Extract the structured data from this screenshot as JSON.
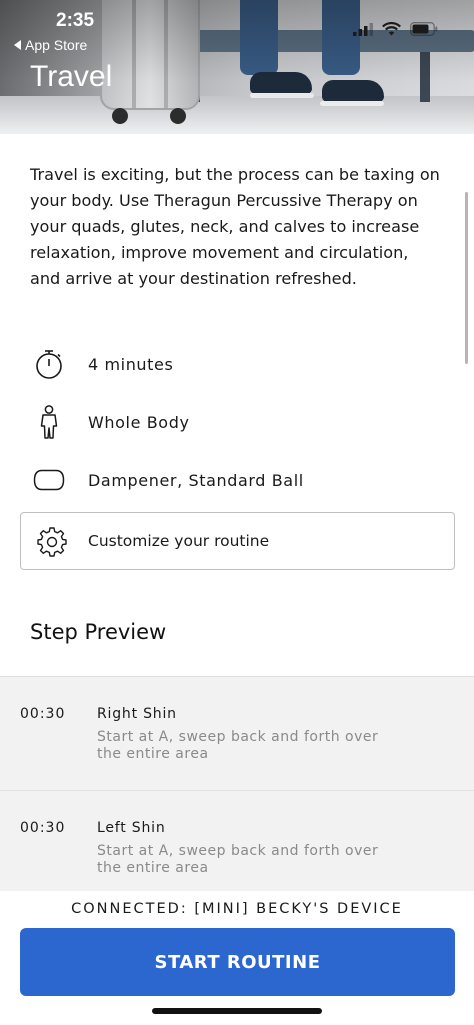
{
  "status_bar": {
    "time": "2:35",
    "back_label": "App Store",
    "icons": [
      "cellular-signal",
      "wifi",
      "battery"
    ]
  },
  "header": {
    "title": "Travel"
  },
  "description": "Travel is exciting, but the process can be taxing on your body. Use Theragun Percussive Therapy on your quads, glutes, neck, and calves to increase relaxation, improve movement and circulation, and arrive at your destination refreshed.",
  "info": {
    "duration": {
      "icon": "stopwatch-icon",
      "label": "4 minutes"
    },
    "body_area": {
      "icon": "person-icon",
      "label": "Whole Body"
    },
    "attachments": {
      "icon": "dampener-icon",
      "label": "Dampener, Standard Ball"
    }
  },
  "customize": {
    "icon": "gear-icon",
    "label": "Customize your routine"
  },
  "step_preview": {
    "title": "Step Preview",
    "steps": [
      {
        "time": "00:30",
        "name": "Right Shin",
        "instruction": "Start at A, sweep back and forth over the entire area"
      },
      {
        "time": "00:30",
        "name": "Left Shin",
        "instruction": "Start at A, sweep back and forth over the entire area"
      }
    ]
  },
  "footer": {
    "connected_text": "CONNECTED: [MINI] BECKY'S DEVICE",
    "start_button_label": "START ROUTINE",
    "accent_color": "#2b67cf"
  }
}
